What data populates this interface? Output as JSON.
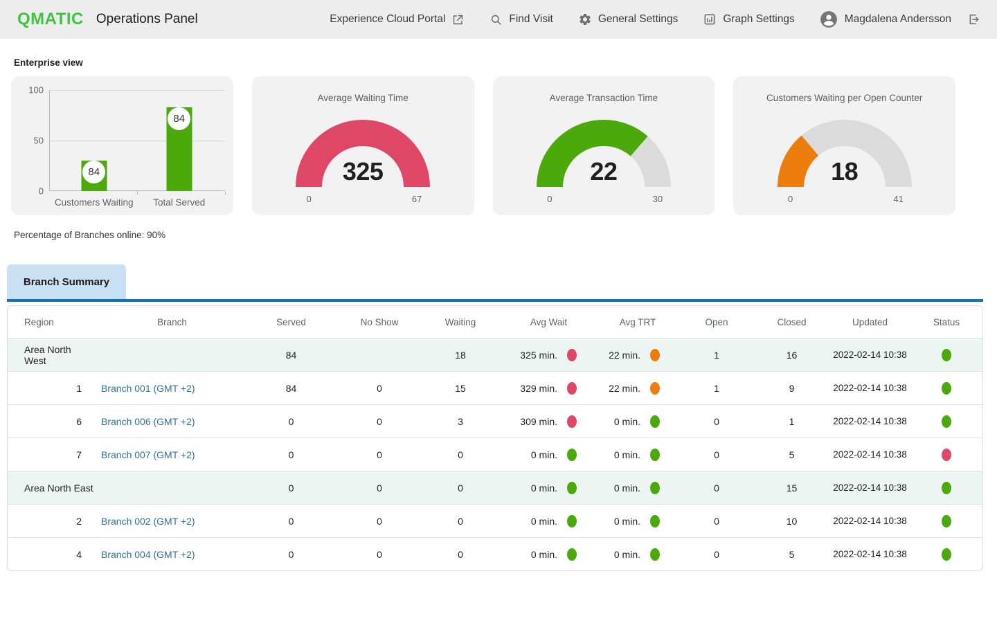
{
  "header": {
    "logo": "QMATIC",
    "title": "Operations Panel",
    "nav": [
      {
        "label": "Experience Cloud Portal"
      },
      {
        "label": "Find Visit"
      },
      {
        "label": "General Settings"
      },
      {
        "label": "Graph Settings"
      },
      {
        "label": "Magdalena Andersson"
      }
    ]
  },
  "enterprise": {
    "section_label": "Enterprise view",
    "branches_online_text": "Percentage of Branches online: 90%"
  },
  "chart_data": [
    {
      "type": "bar",
      "categories": [
        "Customers Waiting",
        "Total Served"
      ],
      "values": [
        84,
        84
      ],
      "bar_heights_pct": [
        30,
        83
      ],
      "ylim": [
        0,
        100
      ],
      "yticks": [
        0,
        50,
        100
      ],
      "bar_color": "#4CA90B",
      "grid": true
    },
    {
      "type": "gauge",
      "title": "Average Waiting Time",
      "value": 325,
      "min": 0,
      "max": 67,
      "fill_color": "#DE4866",
      "fill_fraction": 1
    },
    {
      "type": "gauge",
      "title": "Average Transaction Time",
      "value": 22,
      "min": 0,
      "max": 30,
      "fill_color": "#4CA90B",
      "fill_fraction": 0.73
    },
    {
      "type": "gauge",
      "title": "Customers Waiting per Open Counter",
      "value": 18,
      "min": 0,
      "max": 41,
      "fill_color": "#EC7C0C",
      "fill_fraction": 0.28
    }
  ],
  "tabs": {
    "branch_summary": "Branch Summary"
  },
  "table": {
    "columns": [
      "Region",
      "Branch",
      "Served",
      "No Show",
      "Waiting",
      "Avg Wait",
      "Avg TRT",
      "Open",
      "Closed",
      "Updated",
      "Status"
    ],
    "rows": [
      {
        "type": "area",
        "region": "Area North West",
        "branch": "",
        "served": "84",
        "no_show": "",
        "waiting": "18",
        "avg_wait": "325 min.",
        "avg_wait_color": "pink",
        "avg_trt": "22 min.",
        "avg_trt_color": "orange",
        "open": "1",
        "closed": "16",
        "updated": "2022-02-14 10:38",
        "status_color": "green"
      },
      {
        "type": "branch",
        "region": "1",
        "branch": "Branch 001 (GMT +2)",
        "served": "84",
        "no_show": "0",
        "waiting": "15",
        "avg_wait": "329 min.",
        "avg_wait_color": "pink",
        "avg_trt": "22 min.",
        "avg_trt_color": "orange",
        "open": "1",
        "closed": "9",
        "updated": "2022-02-14 10:38",
        "status_color": "green"
      },
      {
        "type": "branch",
        "region": "6",
        "branch": "Branch 006 (GMT +2)",
        "served": "0",
        "no_show": "0",
        "waiting": "3",
        "avg_wait": "309 min.",
        "avg_wait_color": "pink",
        "avg_trt": "0 min.",
        "avg_trt_color": "green",
        "open": "0",
        "closed": "1",
        "updated": "2022-02-14 10:38",
        "status_color": "green"
      },
      {
        "type": "branch",
        "region": "7",
        "branch": "Branch 007 (GMT +2)",
        "served": "0",
        "no_show": "0",
        "waiting": "0",
        "avg_wait": "0 min.",
        "avg_wait_color": "green",
        "avg_trt": "0 min.",
        "avg_trt_color": "green",
        "open": "0",
        "closed": "5",
        "updated": "2022-02-14 10:38",
        "status_color": "pink"
      },
      {
        "type": "area",
        "region": "Area North East",
        "branch": "",
        "served": "0",
        "no_show": "0",
        "waiting": "0",
        "avg_wait": "0 min.",
        "avg_wait_color": "green",
        "avg_trt": "0 min.",
        "avg_trt_color": "green",
        "open": "0",
        "closed": "15",
        "updated": "2022-02-14 10:38",
        "status_color": "green"
      },
      {
        "type": "branch",
        "region": "2",
        "branch": "Branch 002 (GMT +2)",
        "served": "0",
        "no_show": "0",
        "waiting": "0",
        "avg_wait": "0 min.",
        "avg_wait_color": "green",
        "avg_trt": "0 min.",
        "avg_trt_color": "green",
        "open": "0",
        "closed": "10",
        "updated": "2022-02-14 10:38",
        "status_color": "green"
      },
      {
        "type": "branch",
        "region": "4",
        "branch": "Branch 004 (GMT +2)",
        "served": "0",
        "no_show": "0",
        "waiting": "0",
        "avg_wait": "0 min.",
        "avg_wait_color": "green",
        "avg_trt": "0 min.",
        "avg_trt_color": "green",
        "open": "0",
        "closed": "5",
        "updated": "2022-02-14 10:38",
        "status_color": "green"
      }
    ]
  },
  "colors": {
    "green": "#4CA90B",
    "pink": "#DE4866",
    "orange": "#EC7C0C",
    "gauge_track": "#DBDBDB",
    "brand_green": "#3EC53E",
    "tab_underline": "#1473BB",
    "tab_bg": "#C9E1F2",
    "link_blue": "#2E6F9E"
  }
}
